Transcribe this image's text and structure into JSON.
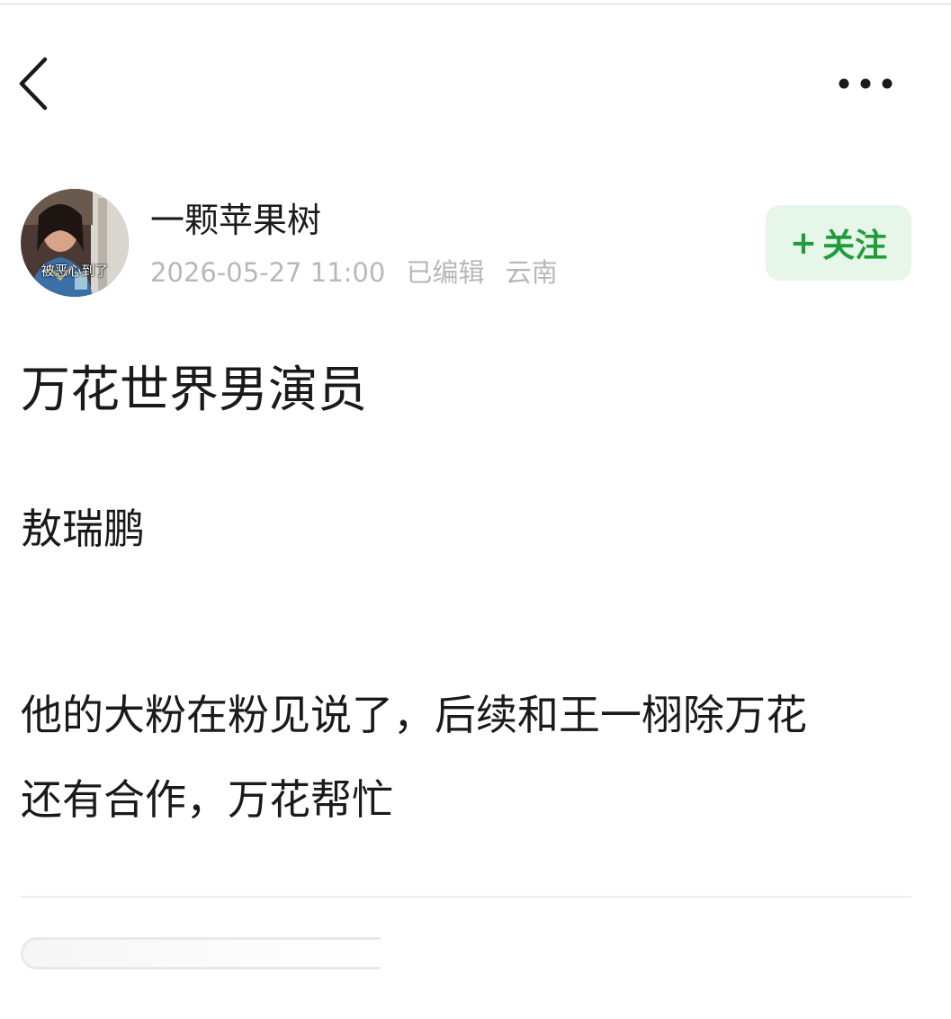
{
  "header": {
    "back_icon": "chevron-left-icon",
    "more_icon": "more-horizontal-icon"
  },
  "author": {
    "name": "一颗苹果树",
    "avatar_caption": "被恶心到了",
    "date": "2026-05-27 11:00",
    "edited": "已编辑",
    "location": "云南"
  },
  "follow_button": {
    "plus": "+",
    "label": "关注",
    "color": "#1f9d3a",
    "background": "#e6f6e9"
  },
  "post": {
    "title": "万花世界男演员",
    "paragraph1": "敖瑞鹏",
    "paragraph2_line1": "他的大粉在粉见说了，后续和王一栩除万花",
    "paragraph2_line2": "还有合作，万花帮忙"
  }
}
